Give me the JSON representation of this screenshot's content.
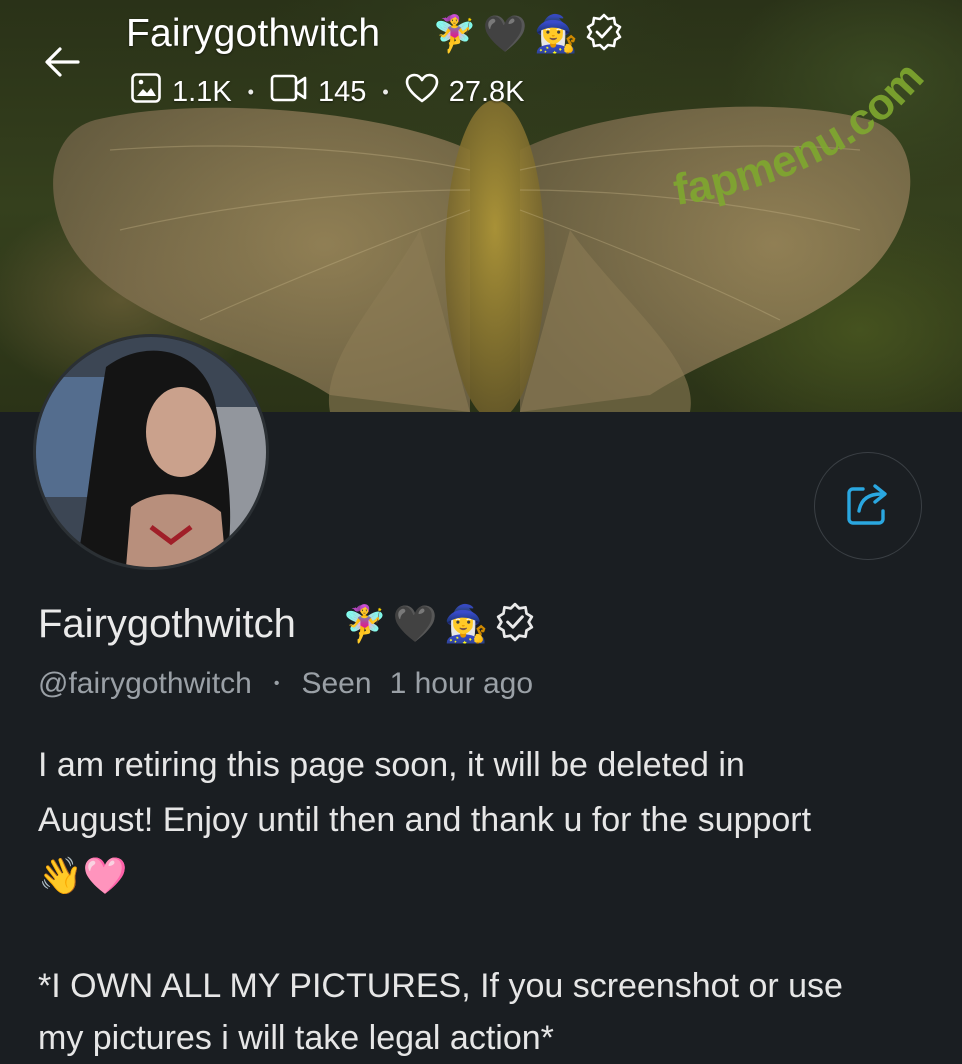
{
  "header": {
    "title": "Fairygothwitch",
    "title_emojis": [
      "🧚‍♀️",
      "🖤",
      "🧙‍♀️"
    ],
    "stats": {
      "photos": "1.1K",
      "videos": "145",
      "likes": "27.8K",
      "separator": "•"
    }
  },
  "watermark": "fapmenu.com",
  "profile": {
    "display_name": "Fairygothwitch",
    "name_emojis": [
      "🧚‍♀️",
      "🖤",
      "🧙‍♀️"
    ],
    "handle": "@fairygothwitch",
    "separator": "•",
    "seen_label": "Seen",
    "seen_time": "1 hour ago",
    "bio_line1": "I am retiring this page soon, it will be deleted in",
    "bio_line2": "August! Enjoy until then and thank u for the support",
    "bio_emojis": "👋🩷",
    "bio_line3": "*I OWN ALL MY PICTURES, If you screenshot or use",
    "bio_line4": "my pictures i will take legal action*"
  },
  "colors": {
    "background": "#1a1e22",
    "accent": "#2aa7e0",
    "muted_text": "#9aa0a6",
    "watermark": "#7fa82f"
  },
  "icons": [
    "back-arrow-icon",
    "image-icon",
    "video-icon",
    "heart-icon",
    "verified-icon",
    "share-icon"
  ]
}
